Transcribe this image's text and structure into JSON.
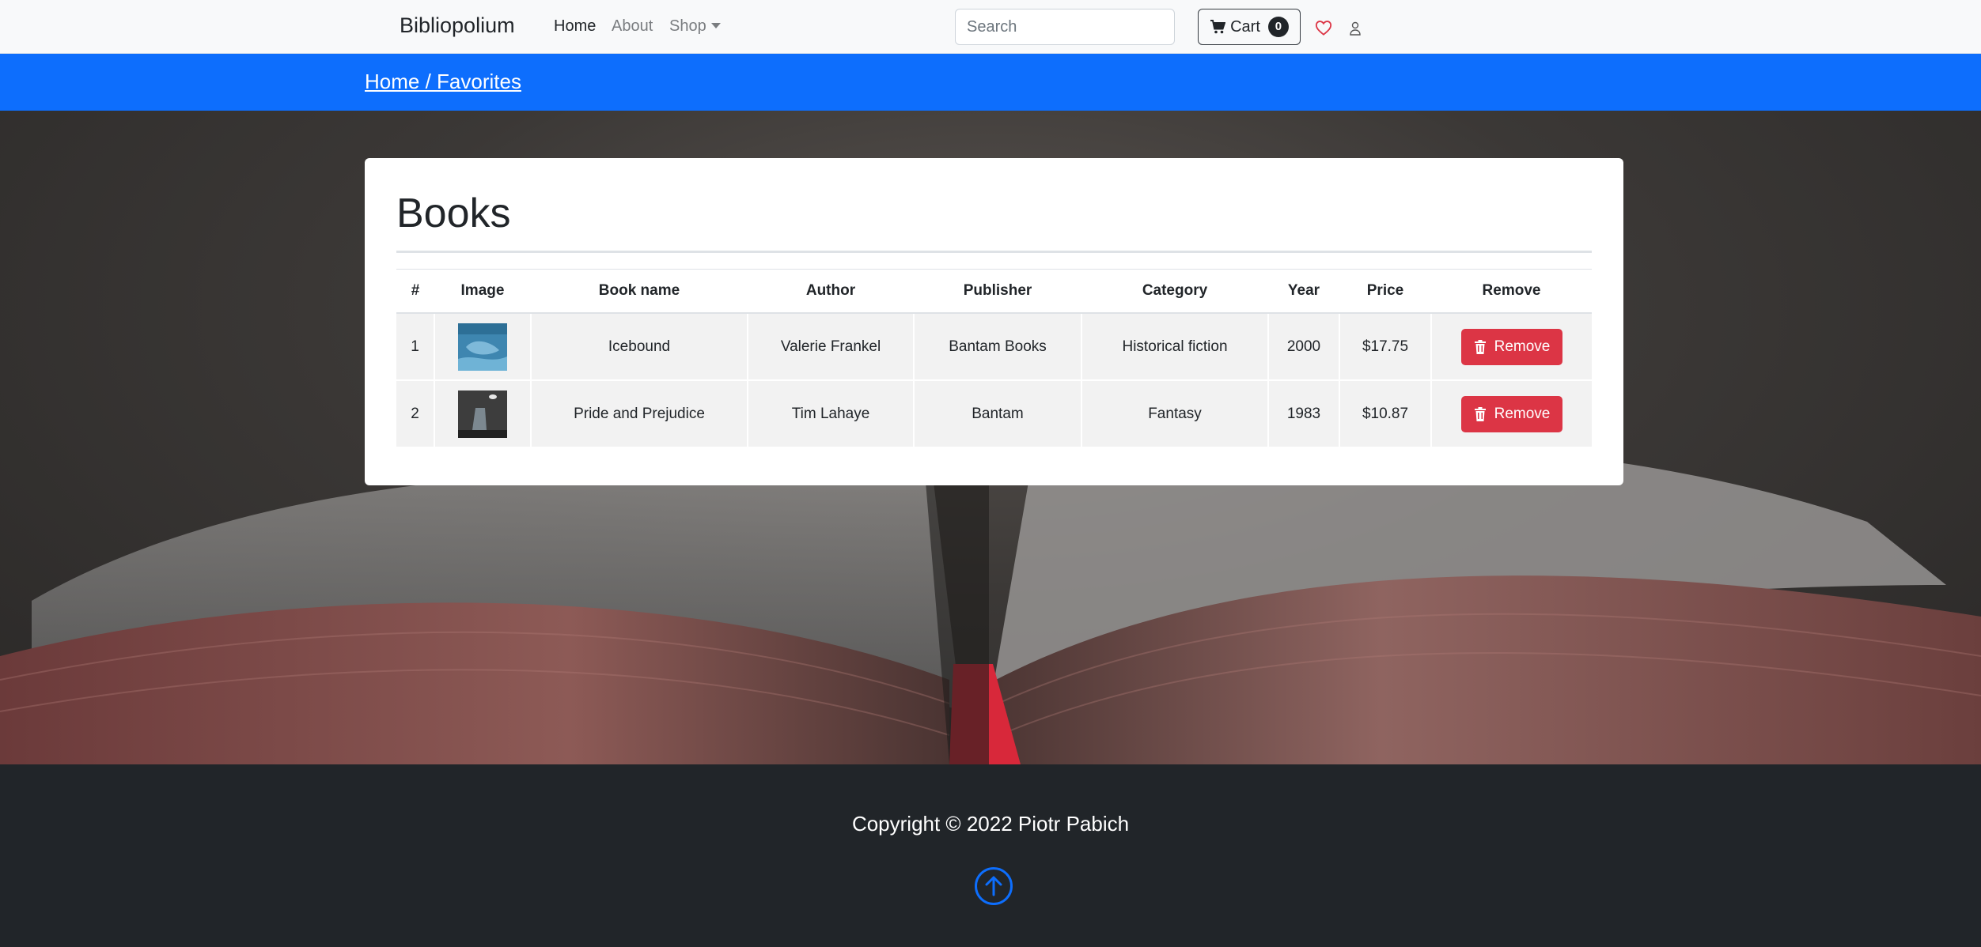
{
  "navbar": {
    "brand": "Bibliopolium",
    "links": [
      {
        "label": "Home",
        "active": true
      },
      {
        "label": "About",
        "active": false
      },
      {
        "label": "Shop",
        "active": false
      }
    ],
    "search_placeholder": "Search",
    "cart_label": "Cart",
    "cart_count": "0",
    "icons": [
      "cart-icon",
      "heart-icon",
      "user-icon"
    ]
  },
  "breadcrumb": {
    "text": "Home / Favorites"
  },
  "card": {
    "title": "Books",
    "columns": [
      "#",
      "Image",
      "Book name",
      "Author",
      "Publisher",
      "Category",
      "Year",
      "Price",
      "Remove"
    ],
    "rows": [
      {
        "num": "1",
        "image": "icebound-cover",
        "name": "Icebound",
        "author": "Valerie Frankel",
        "publisher": "Bantam Books",
        "category": "Historical fiction",
        "year": "2000",
        "price": "$17.75",
        "remove_label": "Remove"
      },
      {
        "num": "2",
        "image": "pride-and-prejudice-cover",
        "name": "Pride and Prejudice",
        "author": "Tim Lahaye",
        "publisher": "Bantam",
        "category": "Fantasy",
        "year": "1983",
        "price": "$10.87",
        "remove_label": "Remove"
      }
    ]
  },
  "footer": {
    "copyright": "Copyright © 2022 Piotr Pabich",
    "back_to_top_icon": "arrow-up-circle-icon"
  },
  "colors": {
    "primary": "#0d6efd",
    "danger": "#dc3545",
    "dark": "#212529",
    "light": "#f8f9fa"
  }
}
